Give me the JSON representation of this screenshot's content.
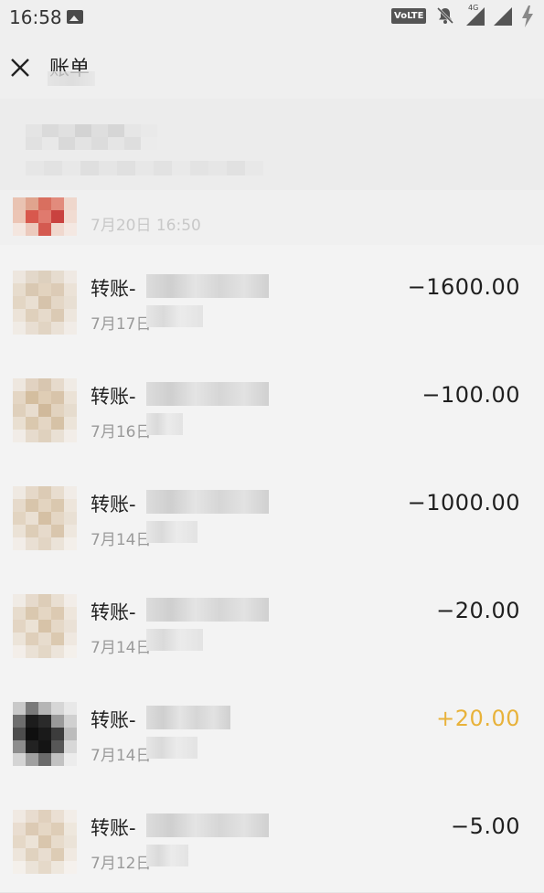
{
  "status_bar": {
    "time": "16:58",
    "volte": "VoLTE",
    "network": "4G"
  },
  "header": {
    "title": "账单"
  },
  "partial_row": {
    "date": "7月20日 16:50"
  },
  "transactions": [
    {
      "title": "转账-",
      "date": "7月17日",
      "amount": "−1600.00",
      "type": "expense"
    },
    {
      "title": "转账-",
      "date": "7月16日",
      "amount": "−100.00",
      "type": "expense"
    },
    {
      "title": "转账-",
      "date": "7月14日",
      "amount": "−1000.00",
      "type": "expense"
    },
    {
      "title": "转账-",
      "date": "7月14日",
      "amount": "−20.00",
      "type": "expense"
    },
    {
      "title": "转账-",
      "date": "7月14日",
      "amount": "+20.00",
      "type": "income"
    },
    {
      "title": "转账-",
      "date": "7月12日",
      "amount": "−5.00",
      "type": "expense"
    }
  ],
  "colors": {
    "income": "#e8b23a",
    "expense": "#1f1f1f",
    "background": "#efefef"
  },
  "icons": [
    "image-notification-icon",
    "bell-off-icon",
    "signal-icon",
    "charging-icon",
    "close-icon"
  ]
}
